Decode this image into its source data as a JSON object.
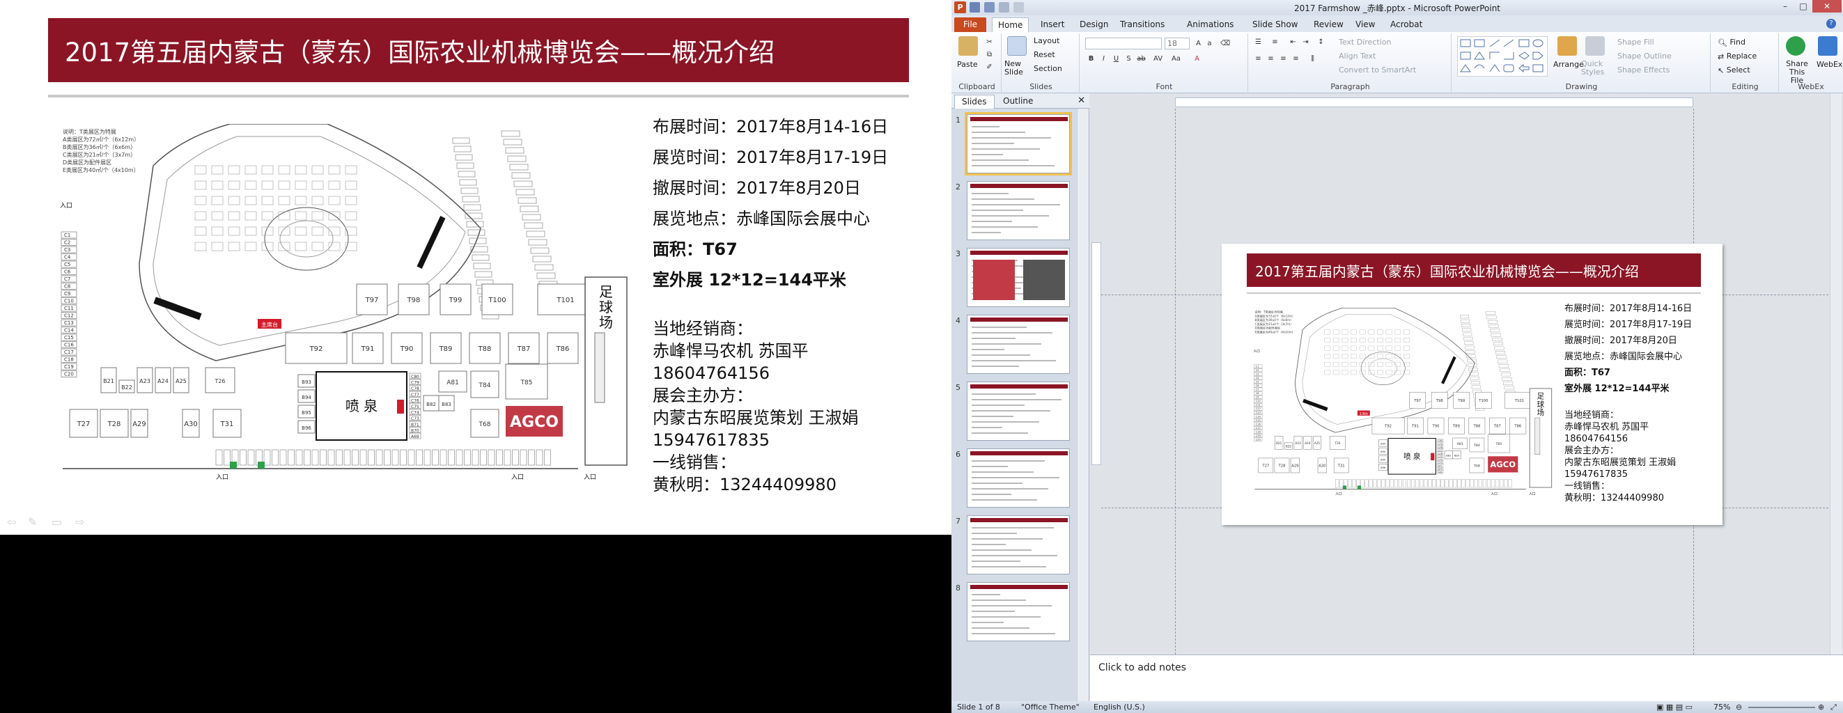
{
  "slide": {
    "title": "2017第五届内蒙古（蒙东）国际农业机械博览会——概况介绍",
    "info_lines": [
      "布展时间：2017年8月14-16日",
      "展览时间：2017年8月17-19日",
      "撤展时间：2017年8月20日",
      "展览地点：赤峰国际会展中心"
    ],
    "bold_lines": [
      "面积：T67",
      "室外展 12*12=144平米"
    ],
    "contact_lines": [
      "当地经销商：",
      "赤峰悍马农机 苏国平",
      "18604764156",
      "展会主办方：",
      " 内蒙古东昭展览策划 王淑娟",
      "15947617835",
      "一线销售：",
      "黄秋明：13244409980"
    ],
    "map": {
      "legend": [
        "说明：T类展区为特展",
        "A类展区为72㎡/个（6x12m）",
        "B类展区为36㎡/个（6x6m）",
        "C类展区为21㎡/个（3x7m）",
        "D类展区为配件展区",
        "E类展区为40㎡/个（4x10m）"
      ],
      "entrance": "入口",
      "stage": "主席台",
      "football": "足球场",
      "fountain": "喷  泉",
      "agco": "AGCO",
      "booths_upper": [
        "T97",
        "T98",
        "T99",
        "T100",
        "T101"
      ],
      "booths_mid": [
        "T92",
        "T91",
        "T90",
        "T89",
        "T88",
        "T87",
        "T86"
      ],
      "booths_left": [
        "B21",
        "B22",
        "A23",
        "A24",
        "A25",
        "T26"
      ],
      "booths_bottom": [
        "T27",
        "T28",
        "A29",
        "A30",
        "T31"
      ],
      "booths_right": [
        "A81",
        "T84",
        "T85",
        "B82",
        "B83",
        "T68"
      ],
      "booths_fountain_left": [
        "B93",
        "B94",
        "B95",
        "B96"
      ],
      "booths_fountain_right": [
        "C80",
        "C79",
        "C78",
        "C77",
        "C76",
        "C75",
        "C74",
        "C73",
        "B71",
        "B70",
        "A69"
      ],
      "c_column": [
        "C1",
        "C2",
        "C3",
        "C4",
        "C5",
        "C6",
        "C7",
        "C8",
        "C9",
        "C10",
        "C11",
        "C12",
        "C13",
        "C14",
        "C15",
        "C16",
        "C17",
        "C18",
        "C19",
        "C20"
      ]
    }
  },
  "window": {
    "title": "2017 Farmshow _赤峰.pptx - Microsoft PowerPoint",
    "app_letter": "P"
  },
  "tabs": [
    "File",
    "Home",
    "Insert",
    "Design",
    "Transitions",
    "Animations",
    "Slide Show",
    "Review",
    "View",
    "Acrobat"
  ],
  "ribbon": {
    "clipboard": {
      "label": "Clipboard",
      "paste": "Paste"
    },
    "slides": {
      "label": "Slides",
      "new_slide": "New Slide",
      "layout": "Layout",
      "reset": "Reset",
      "section": "Section"
    },
    "font": {
      "label": "Font",
      "size": "18"
    },
    "paragraph": {
      "label": "Paragraph",
      "text_direction": "Text Direction",
      "align_text": "Align Text",
      "convert": "Convert to SmartArt"
    },
    "drawing": {
      "label": "Drawing",
      "arrange": "Arrange",
      "quick_styles": "Quick Styles",
      "shape_fill": "Shape Fill",
      "shape_outline": "Shape Outline",
      "shape_effects": "Shape Effects"
    },
    "editing": {
      "label": "Editing",
      "find": "Find",
      "replace": "Replace",
      "select": "Select"
    },
    "webex": {
      "label": "WebEx",
      "share": "Share This File",
      "webex": "WebEx"
    }
  },
  "slides_pane": {
    "tab_slides": "Slides",
    "tab_outline": "Outline",
    "numbers": [
      "1",
      "2",
      "3",
      "4",
      "5",
      "6",
      "7",
      "8"
    ]
  },
  "notes": {
    "placeholder": "Click to add notes"
  },
  "status": {
    "slide": "Slide 1 of 8",
    "theme": "\"Office Theme\"",
    "language": "English (U.S.)",
    "zoom": "75%"
  },
  "colors": {
    "accent": "#8b1525",
    "agco": "#c23a46",
    "file_tab": "#c94a1f"
  }
}
